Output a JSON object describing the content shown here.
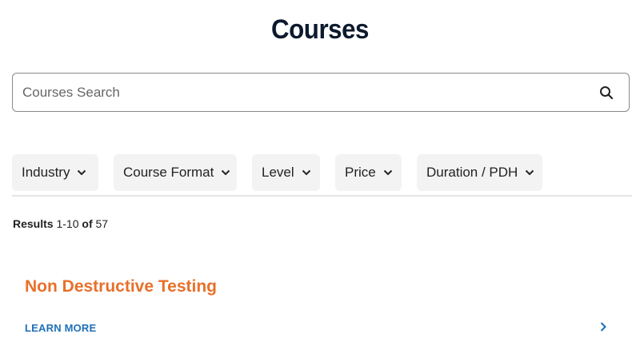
{
  "page": {
    "title": "Courses"
  },
  "search": {
    "placeholder": "Courses Search",
    "value": "",
    "icon": "search-icon"
  },
  "filters": [
    {
      "label": "Industry",
      "icon": "chevron-down-icon"
    },
    {
      "label": "Course Format",
      "icon": "chevron-down-icon"
    },
    {
      "label": "Level",
      "icon": "chevron-down-icon"
    },
    {
      "label": "Price",
      "icon": "chevron-down-icon"
    },
    {
      "label": "Duration / PDH",
      "icon": "chevron-down-icon"
    }
  ],
  "results": {
    "prefix": "Results",
    "range": "1-10",
    "of_label": "of",
    "total": "57"
  },
  "courses": [
    {
      "title": "Non Destructive Testing",
      "link_label": "LEARN MORE",
      "icon": "chevron-right-icon"
    }
  ],
  "colors": {
    "title": "#0c1a2e",
    "course_title": "#e8702a",
    "link": "#1f6fb8",
    "filter_bg": "#f3f3f3",
    "border": "#8a8a8a"
  }
}
